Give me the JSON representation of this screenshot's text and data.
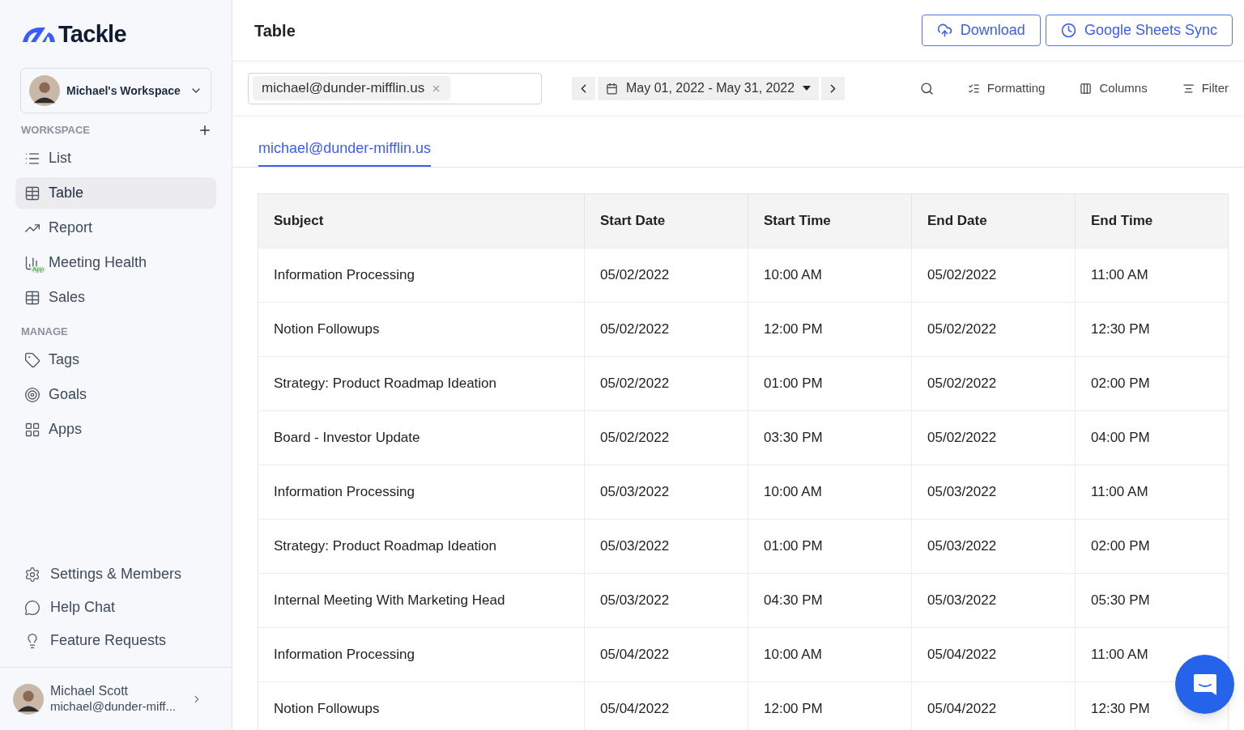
{
  "brand": "Tackle",
  "workspace": {
    "name": "Michael's Workspace"
  },
  "sidebar": {
    "sections": [
      {
        "title": "WORKSPACE",
        "add": true,
        "items": [
          {
            "label": "List",
            "selected": false
          },
          {
            "label": "Table",
            "selected": true
          },
          {
            "label": "Report",
            "selected": false
          },
          {
            "label": "Meeting Health",
            "selected": false,
            "badge": "App"
          },
          {
            "label": "Sales",
            "selected": false
          }
        ]
      },
      {
        "title": "MANAGE",
        "add": false,
        "items": [
          {
            "label": "Tags",
            "selected": false
          },
          {
            "label": "Goals",
            "selected": false
          },
          {
            "label": "Apps",
            "selected": false
          }
        ]
      }
    ],
    "footer_items": [
      {
        "label": "Settings & Members"
      },
      {
        "label": "Help Chat"
      },
      {
        "label": "Feature Requests"
      }
    ],
    "user": {
      "name": "Michael Scott",
      "email": "michael@dunder-miff..."
    }
  },
  "header": {
    "title": "Table",
    "buttons": [
      {
        "label": "Download"
      },
      {
        "label": "Google Sheets Sync"
      }
    ]
  },
  "toolbar": {
    "filter_chip": "michael@dunder-mifflin.us",
    "date_range": "May 01, 2022 - May 31, 2022",
    "actions": [
      {
        "label": "Formatting"
      },
      {
        "label": "Columns"
      },
      {
        "label": "Filter"
      }
    ]
  },
  "tabs": [
    {
      "label": "michael@dunder-mifflin.us",
      "selected": true
    }
  ],
  "table": {
    "columns": [
      "Subject",
      "Start Date",
      "Start Time",
      "End Date",
      "End Time"
    ],
    "rows": [
      [
        "Information Processing",
        "05/02/2022",
        "10:00 AM",
        "05/02/2022",
        "11:00 AM"
      ],
      [
        "Notion Followups",
        "05/02/2022",
        "12:00 PM",
        "05/02/2022",
        "12:30 PM"
      ],
      [
        "Strategy: Product Roadmap Ideation",
        "05/02/2022",
        "01:00 PM",
        "05/02/2022",
        "02:00 PM"
      ],
      [
        "Board - Investor Update",
        "05/02/2022",
        "03:30 PM",
        "05/02/2022",
        "04:00 PM"
      ],
      [
        "Information Processing",
        "05/03/2022",
        "10:00 AM",
        "05/03/2022",
        "11:00 AM"
      ],
      [
        "Strategy: Product Roadmap Ideation",
        "05/03/2022",
        "01:00 PM",
        "05/03/2022",
        "02:00 PM"
      ],
      [
        "Internal Meeting With Marketing Head",
        "05/03/2022",
        "04:30 PM",
        "05/03/2022",
        "05:30 PM"
      ],
      [
        "Information Processing",
        "05/04/2022",
        "10:00 AM",
        "05/04/2022",
        "11:00 AM"
      ],
      [
        "Notion Followups",
        "05/04/2022",
        "12:00 PM",
        "05/04/2022",
        "12:30 PM"
      ]
    ]
  }
}
